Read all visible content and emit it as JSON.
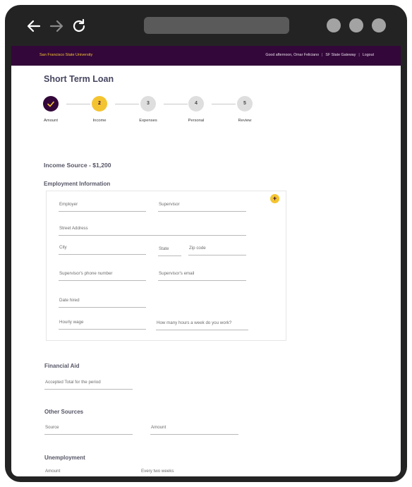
{
  "header": {
    "university": "San Francisco State University",
    "greeting": "Good afternoon, Omar Feliciano",
    "gateway_link": "SF State Gateway",
    "logout_link": "Logout",
    "separator": "|"
  },
  "page_title": "Short Term Loan",
  "steps": [
    {
      "number": "1",
      "label": "Amount",
      "status": "done",
      "icon": "check-icon"
    },
    {
      "number": "2",
      "label": "Income",
      "status": "active"
    },
    {
      "number": "3",
      "label": "Expenses",
      "status": "pending"
    },
    {
      "number": "4",
      "label": "Personal",
      "status": "pending"
    },
    {
      "number": "5",
      "label": "Review",
      "status": "pending"
    }
  ],
  "income_source": "Income Source -  $1,200",
  "employment": {
    "title": "Employment Information",
    "add_label": "+",
    "fields": {
      "employer": "Employer",
      "supervisor": "Supervisor",
      "street": "Street Address",
      "city": "City",
      "state": "State",
      "zip": "Zip code",
      "sup_phone": "Supervisor's phone number",
      "sup_email": "Supervisor's email",
      "date_hired": "Date hired",
      "hourly_wage": "Hourly wage",
      "hours_week": "How many hours a week do you work?"
    }
  },
  "financial_aid": {
    "title": "Financial Aid",
    "fields": {
      "accepted_total": "Accepted Total for the period"
    }
  },
  "other_sources": {
    "title": "Other Sources",
    "fields": {
      "source": "Source",
      "amount": "Amount"
    }
  },
  "unemployment": {
    "title": "Unemployment",
    "fields": {
      "amount": "Amount",
      "frequency": "Every two weeks"
    }
  },
  "colors": {
    "brand_purple": "#33073a",
    "brand_gold": "#f4c430",
    "frame": "#232323"
  }
}
